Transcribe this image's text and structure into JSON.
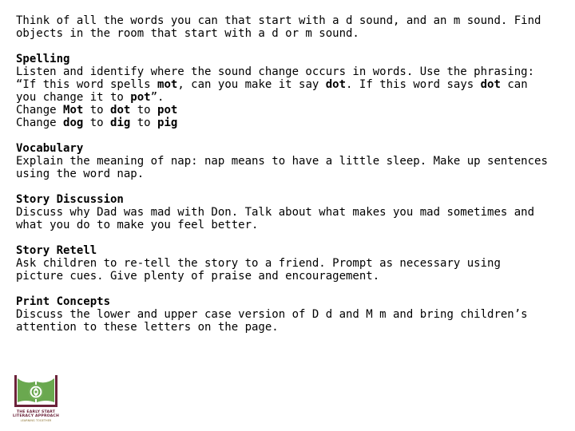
{
  "page": {
    "background_color": "#ffffff",
    "text_color": "#000000"
  },
  "intro": {
    "lines": [
      "Think of all the words you can that start with a d sound, and an m sound. Find",
      "objects in the room that start with a d or m sound."
    ]
  },
  "sections": [
    {
      "id": "spelling",
      "heading": "Spelling",
      "lines": [
        "Listen and identify where the sound change occurs in words. Use the phrasing:",
        "“If this word spells mot, can you make it say dot. If this word says dot can",
        "you change it to pot”.",
        "Change Mot to dot to pot",
        "Change dog to dig to pig"
      ],
      "bold_words": [
        "mot",
        "dot",
        "dot",
        "pot",
        "Mot",
        "dot",
        "pot",
        "dog",
        "dig",
        "pig"
      ]
    },
    {
      "id": "vocabulary",
      "heading": "Vocabulary",
      "lines": [
        "Explain the meaning of nap: nap means to have a little sleep. Make up sentences",
        "using the word nap."
      ],
      "bold_words": []
    },
    {
      "id": "story-discussion",
      "heading": "Story Discussion",
      "lines": [
        "Discuss why Dad was mad with Don. Talk about what makes you mad sometimes and",
        "what you do to make you feel better."
      ],
      "bold_words": []
    },
    {
      "id": "story-retell",
      "heading": "Story Retell",
      "lines": [
        "Ask children to re-tell the story to a friend. Prompt as necessary using",
        "picture cues. Give plenty of praise and encouragement."
      ],
      "bold_words": []
    },
    {
      "id": "print-concepts",
      "heading": "Print Concepts",
      "lines": [
        "Discuss the lower and upper case version of D d and M m and bring children’s",
        "attention to these letters on the page."
      ],
      "bold_words": []
    }
  ],
  "logo": {
    "title": "THE EARLY START",
    "title2": "LITERACY APPROACH",
    "tagline": "LEARNING TOGETHER",
    "book_color": "#6aa84f",
    "cover_color": "#6b2239",
    "emblem_color": "#6aa84f",
    "title_color": "#6b2239",
    "tagline_color": "#8a6f2e"
  }
}
